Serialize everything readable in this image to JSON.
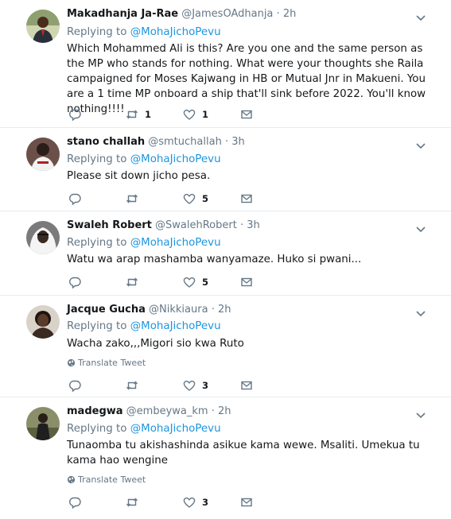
{
  "tweets": [
    {
      "name": "Makadhanja Ja-Rae",
      "handle": "@JamesOAdhanja",
      "dot": "·",
      "time": "2h",
      "replying_prefix": "Replying to",
      "replying_to": "@MohaJichoPevu",
      "text": "Which Mohammed Ali is this? Are you one and the same person as the MP who stands for nothing. What were your thoughts she Raila campaigned for Moses Kajwang in HB or Mutual Jnr in Makueni. You are a 1 time MP onboard a ship that'll sink before 2022. You'll  know nothing!!!!",
      "translate": "",
      "reply_count": "",
      "retweet_count": "1",
      "like_count": "1"
    },
    {
      "name": "stano challah",
      "handle": "@smtuchallah",
      "dot": "·",
      "time": "3h",
      "replying_prefix": "Replying to",
      "replying_to": "@MohaJichoPevu",
      "text": "Please sit down jicho pesa.",
      "translate": "",
      "reply_count": "",
      "retweet_count": "",
      "like_count": "5"
    },
    {
      "name": "Swaleh Robert",
      "handle": "@SwalehRobert",
      "dot": "·",
      "time": "3h",
      "replying_prefix": "Replying to",
      "replying_to": "@MohaJichoPevu",
      "text": "Watu wa arap mashamba wanyamaze. Huko si pwani...",
      "translate": "",
      "reply_count": "",
      "retweet_count": "",
      "like_count": "5"
    },
    {
      "name": "Jacque Gucha",
      "handle": "@Nikkiaura",
      "dot": "·",
      "time": "2h",
      "replying_prefix": "Replying to",
      "replying_to": "@MohaJichoPevu",
      "text": "Wacha zako,,,Migori sio kwa Ruto",
      "translate": "Translate Tweet",
      "reply_count": "",
      "retweet_count": "",
      "like_count": "3"
    },
    {
      "name": "madegwa",
      "handle": "@embeywa_km",
      "dot": "·",
      "time": "2h",
      "replying_prefix": "Replying to",
      "replying_to": "@MohaJichoPevu",
      "text": "Tunaomba tu akishashinda asikue kama wewe. Msaliti. Umekua tu kama hao wengine",
      "translate": "Translate Tweet",
      "reply_count": "",
      "retweet_count": "",
      "like_count": "3"
    }
  ],
  "icons": {
    "reply": "reply-icon",
    "retweet": "retweet-icon",
    "like": "heart-icon",
    "dm": "envelope-icon",
    "more": "chevron-down-icon",
    "translate": "globe-icon"
  },
  "colors": {
    "link": "#1b95e0",
    "secondary": "#657786",
    "text": "#14171a",
    "divider": "#e6ecf0"
  }
}
